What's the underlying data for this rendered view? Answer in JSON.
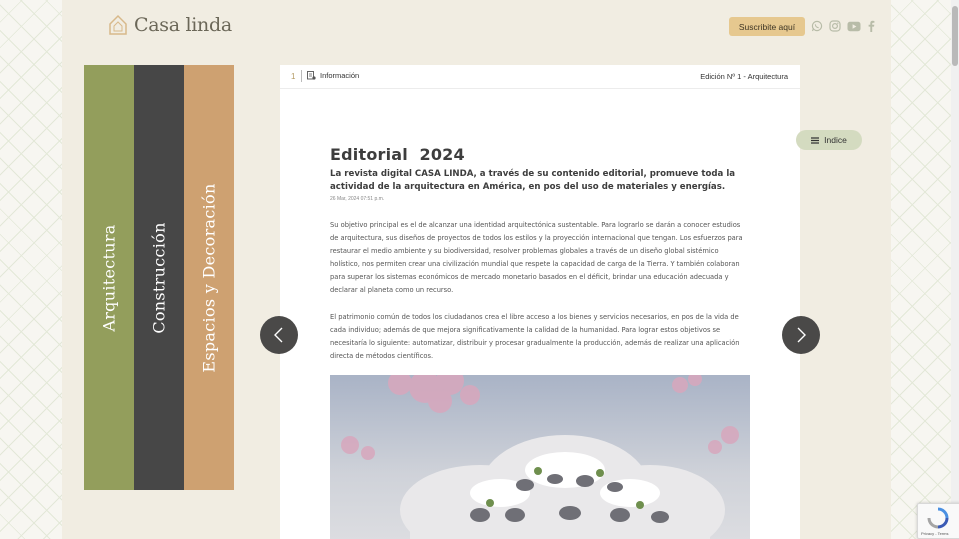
{
  "header": {
    "brand": "Casa linda",
    "subscribe_label": "Suscribite aquí",
    "social_icons": [
      "whatsapp-icon",
      "instagram-icon",
      "youtube-icon",
      "facebook-icon"
    ]
  },
  "sections": [
    {
      "label": "Arquitectura",
      "color": "#939e5c"
    },
    {
      "label": "Construcción",
      "color": "#474747"
    },
    {
      "label": "Espacios y Decoración",
      "color": "#cea171"
    }
  ],
  "document": {
    "page_number": "1",
    "info_label": "Información",
    "edition": "Edición Nº 1 - Arquitectura",
    "title": "Editorial  2024",
    "lead": "La revista digital CASA LINDA, a través de su contenido editorial, promueve toda la actividad de la arquitectura en América, en pos del uso de materiales y energías.",
    "date": "26 Mar, 2024  07:51 p.m.",
    "paragraphs": [
      "Su objetivo principal es el de alcanzar una identidad arquitectónica sustentable. Para lograrlo se darán a conocer estudios de arquitectura, sus diseños de proyectos de todos los estilos y la proyección internacional que tengan. Los esfuerzos para restaurar el medio ambiente y su biodiversidad, resolver problemas globales a través de un diseño global sistémico holístico, nos permiten crear una civilización mundial que respete la capacidad de carga de la Tierra. Y también colaboran para superar los sistemas económicos de mercado monetario basados en el déficit, brindar una educación adecuada y declarar al planeta como un recurso.",
      "El patrimonio común de todos los ciudadanos crea el libre acceso a los bienes y servicios necesarios, en pos de la vida de cada individuo; además de que mejora significativamente la calidad de la humanidad. Para lograr estos objetivos se necesitaría lo siguiente: automatizar, distribuir y procesar gradualmente la producción, además de realizar una aplicación directa de métodos científicos."
    ]
  },
  "indice_label": "Indice",
  "recaptcha_text": "Privacy - Terms",
  "colors": {
    "accent_gold": "#e6c88f",
    "indice_bg": "#d4dbc0",
    "page_bg": "#f1ede2"
  }
}
